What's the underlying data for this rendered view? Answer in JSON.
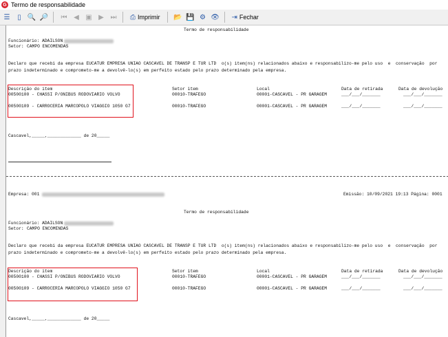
{
  "window": {
    "title": "Termo de responsabilidade"
  },
  "toolbar": {
    "print_label": "Imprimir",
    "close_label": "Fechar"
  },
  "document": {
    "sections": [
      {
        "title": "Termo de responsabilidade",
        "funcionario_label": "Funcionário:",
        "funcionario_name": "ADAILSON",
        "setor_label": "Setor:",
        "setor_value": "CAMPO ENCOMENDAS",
        "declaration_line1": "Declaro que recebi da empresa EUCATUR EMPRESA UNIAO CASCAVEL DE TRANSP E TUR LTD  o(s) item(ns) relacionados abaixo e responsabilizo-me pelo uso  e  conservação  por",
        "declaration_line2": "prazo indeterminado e comprometo-me a devolvê-lo(s) em perfeito estado pelo prazo determinado pela empresa.",
        "headers": {
          "item": "Descrição do item",
          "setor": "Setor item",
          "local": "Local",
          "retirada": "Data de retirada",
          "devolucao": "Data de devolução"
        },
        "rows": [
          {
            "item": "00500100 - CHASSI P/ONIBUS RODOVIARIO VOLVO",
            "setor": "00010-TRAFEGO",
            "local": "00001-CASCAVEL - PR GARAGEM",
            "retirada": "___/___/_______",
            "devolucao": "___/___/_______"
          },
          {
            "item": "00500109 - CARROCERIA MARCOPOLO VIAGGIO 1050 G7",
            "setor": "00010-TRAFEGO",
            "local": "00001-CASCAVEL - PR GARAGEM",
            "retirada": "___/___/_______",
            "devolucao": "___/___/_______"
          }
        ],
        "date_line": "Cascavel,_____,_____________ de 20_____"
      }
    ],
    "page_footer": {
      "empresa": "Empresa: 001",
      "emissao": "Emissão: 10/09/2021 19:13 Página: 0001"
    }
  }
}
